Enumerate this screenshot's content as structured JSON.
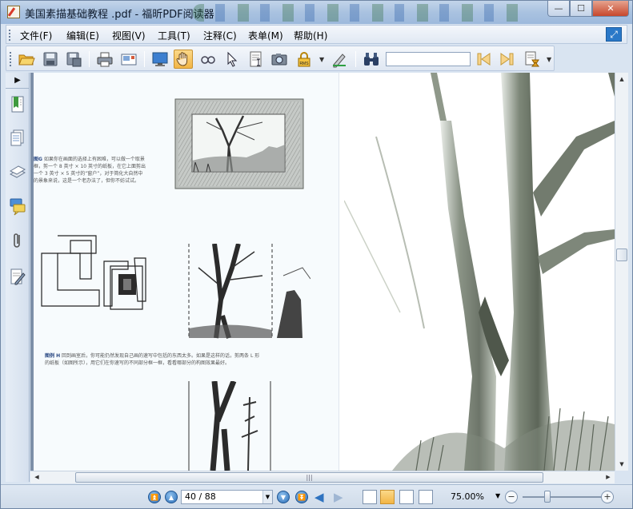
{
  "window": {
    "title": "美国素描基础教程 .pdf - 福昕PDF阅读器",
    "controls": {
      "minimize": "—",
      "maximize": "☐",
      "close": "✕"
    }
  },
  "menubar": {
    "items": [
      {
        "label": "文件(F)"
      },
      {
        "label": "编辑(E)"
      },
      {
        "label": "视图(V)"
      },
      {
        "label": "工具(T)"
      },
      {
        "label": "注释(C)"
      },
      {
        "label": "表单(M)"
      },
      {
        "label": "帮助(H)"
      }
    ]
  },
  "toolbar": {
    "rms_label": "RMS",
    "search": {
      "value": "",
      "placeholder": ""
    }
  },
  "document": {
    "left_page": {
      "caption_g_label": "图G",
      "caption_g_lines": [
        "如果你在画面的选择上有困难，可以做一个取景",
        "框，剪一个 8 英寸 × 10 英寸的纸板，在它上面剪出",
        "一个 3 英寸 × 5 英寸的“窗户”，对于简化大自然中",
        "的景象来说，这是一个老办法了，但你不妨试试。"
      ],
      "caption_h_label": "图例 H",
      "caption_h_lines": [
        "回到画室后，你可能仍然发现自己画的速写中包括的东西太多。如果是这样的话，剪两条 L 形",
        "的纸板（如图所示），用它们在你速写的不同部分框一框，看看哪部分的构图效果最好。"
      ]
    }
  },
  "scrollbar": {
    "h_grip": "|||"
  },
  "statusbar": {
    "current_page": "40",
    "page_separator": "/",
    "total_pages": "88",
    "zoom": "75.00%",
    "zoom_out": "−",
    "zoom_in": "+"
  },
  "colors": {
    "accent": "#2c6fb8",
    "active_tool": "#f2b545",
    "window_frame": "#d9e4f1"
  }
}
